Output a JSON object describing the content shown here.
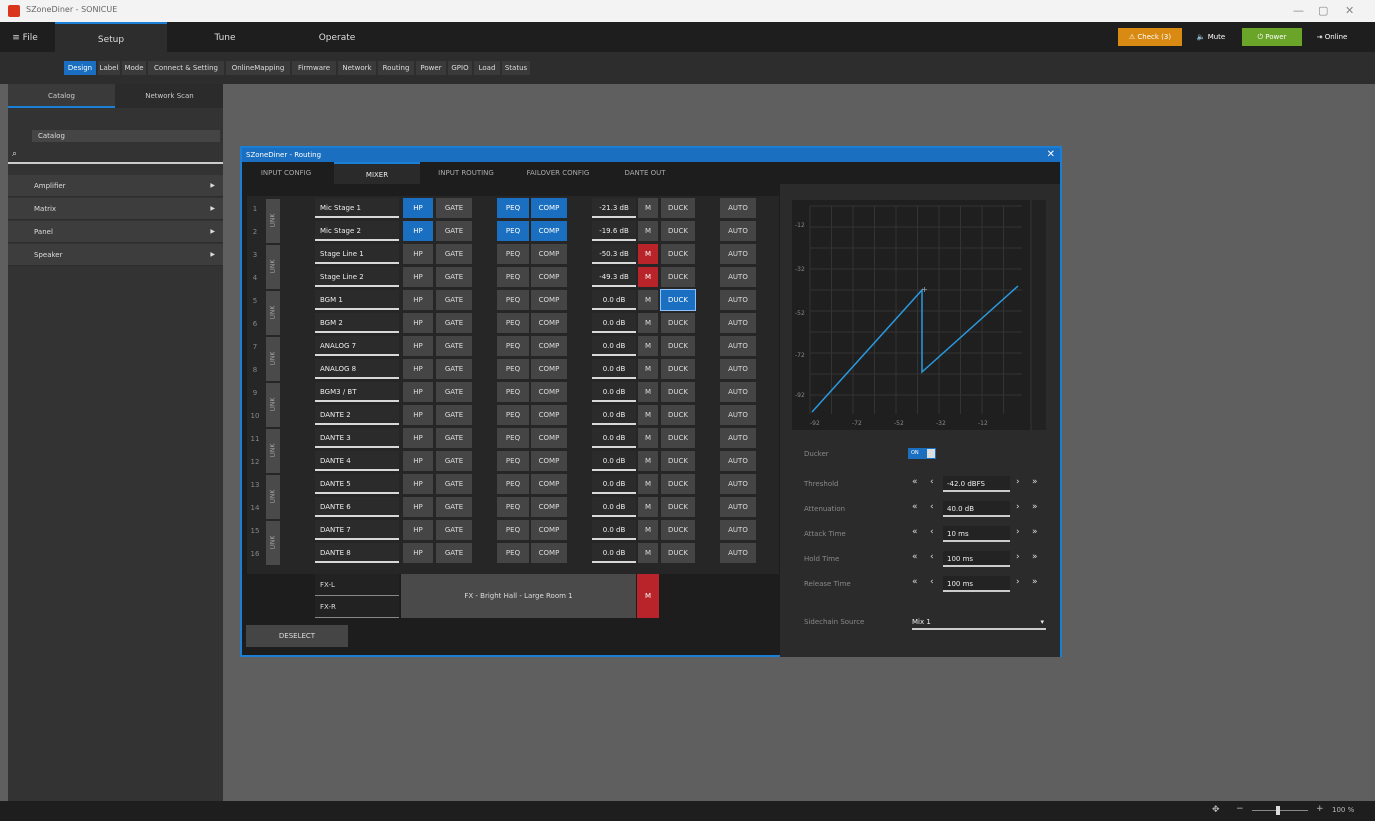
{
  "window": {
    "title": "SZoneDiner - SONICUE",
    "minimize": "—",
    "maximize": "▢",
    "close": "✕"
  },
  "menu": {
    "file": "≡ File",
    "tabs": [
      "Setup",
      "Tune",
      "Operate"
    ]
  },
  "subtabs": [
    "Design",
    "Label",
    "Mode",
    "Connect & Setting",
    "OnlineMapping",
    "Firmware",
    "Network",
    "Routing",
    "Power",
    "GPIO",
    "Load",
    "Status"
  ],
  "header_buttons": {
    "check": "Check (3)",
    "mute": "Mute",
    "power": "Power",
    "online": "Online"
  },
  "colors": {
    "accent": "#1a6fc0",
    "check": "#d98a12",
    "power": "#6aa52a",
    "mute_red": "#b8242a"
  },
  "sidebar": {
    "tabs": [
      "Catalog",
      "Network Scan"
    ],
    "section": "Catalog",
    "items": [
      "Amplifier",
      "Matrix",
      "Panel",
      "Speaker"
    ]
  },
  "dialog": {
    "title": "SZoneDiner - Routing",
    "tabs": [
      "INPUT CONFIG",
      "MIXER",
      "INPUT ROUTING",
      "FAILOVER CONFIG",
      "DANTE OUT"
    ],
    "link_label": "LINK",
    "col_labels": {
      "hp": "HP",
      "gate": "GATE",
      "peq": "PEQ",
      "comp": "COMP",
      "mute": "M",
      "duck": "DUCK",
      "auto": "AUTO"
    },
    "channels": [
      {
        "num": "1",
        "name": "Mic Stage 1",
        "gain": "-21.3 dB"
      },
      {
        "num": "2",
        "name": "Mic Stage 2",
        "gain": "-19.6 dB"
      },
      {
        "num": "3",
        "name": "Stage Line 1",
        "gain": "-50.3 dB"
      },
      {
        "num": "4",
        "name": "Stage Line 2",
        "gain": "-49.3 dB"
      },
      {
        "num": "5",
        "name": "BGM 1",
        "gain": "0.0 dB"
      },
      {
        "num": "6",
        "name": "BGM 2",
        "gain": "0.0 dB"
      },
      {
        "num": "7",
        "name": "ANALOG 7",
        "gain": "0.0 dB"
      },
      {
        "num": "8",
        "name": "ANALOG 8",
        "gain": "0.0 dB"
      },
      {
        "num": "9",
        "name": "BGM3 / BT",
        "gain": "0.0 dB"
      },
      {
        "num": "10",
        "name": "DANTE 2",
        "gain": "0.0 dB"
      },
      {
        "num": "11",
        "name": "DANTE 3",
        "gain": "0.0 dB"
      },
      {
        "num": "12",
        "name": "DANTE 4",
        "gain": "0.0 dB"
      },
      {
        "num": "13",
        "name": "DANTE 5",
        "gain": "0.0 dB"
      },
      {
        "num": "14",
        "name": "DANTE 6",
        "gain": "0.0 dB"
      },
      {
        "num": "15",
        "name": "DANTE 7",
        "gain": "0.0 dB"
      },
      {
        "num": "16",
        "name": "DANTE 8",
        "gain": "0.0 dB"
      }
    ],
    "fx": {
      "left": "FX-L",
      "right": "FX-R",
      "label": "FX - Bright Hall - Large Room 1",
      "mute": "M"
    },
    "deselect": "DESELECT",
    "ducker": {
      "label": "Ducker",
      "toggle": "ON",
      "graph_y_ticks": [
        "-12",
        "-32",
        "-52",
        "-72",
        "-92"
      ],
      "graph_x_ticks": [
        "-92",
        "-72",
        "-52",
        "-32",
        "-12"
      ],
      "params": [
        {
          "label": "Threshold",
          "value": "-42.0 dBFS"
        },
        {
          "label": "Attenuation",
          "value": "40.0 dB"
        },
        {
          "label": "Attack Time",
          "value": "10 ms"
        },
        {
          "label": "Hold Time",
          "value": "100 ms"
        },
        {
          "label": "Release Time",
          "value": "100 ms"
        }
      ],
      "sidechain": {
        "label": "Sidechain Source",
        "value": "Mix 1"
      }
    }
  },
  "status": {
    "zoom": "100 %"
  }
}
